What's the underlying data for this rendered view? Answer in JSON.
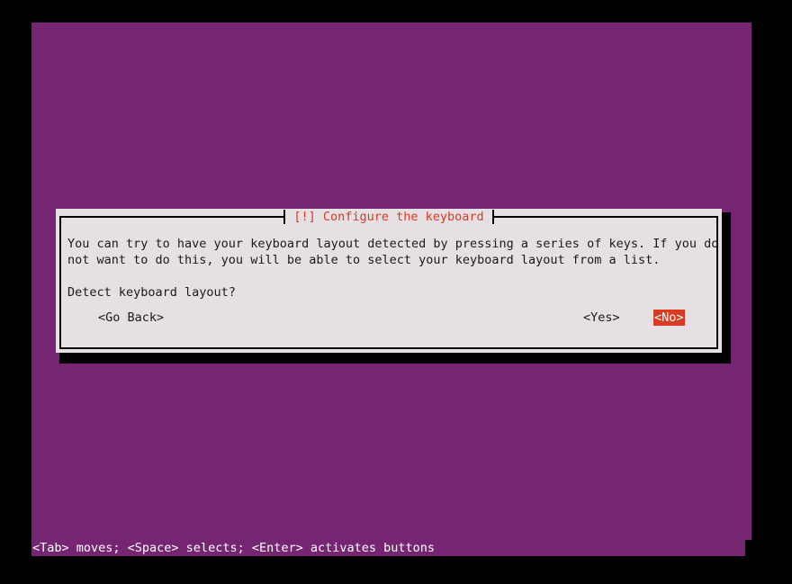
{
  "screen": {
    "background_color": "#000000",
    "terminal_background": "#762572",
    "dialog_background": "#e6e0e4",
    "accent_red": "#d93b22",
    "text_color": "#1a1a1a",
    "highlight_text_color": "#ffffff"
  },
  "dialog": {
    "title": "[!] Configure the keyboard",
    "body_lines": [
      "You can try to have your keyboard layout detected by pressing a series of keys. If you do",
      "not want to do this, you will be able to select your keyboard layout from a list."
    ],
    "question": "Detect keyboard layout?",
    "buttons": [
      {
        "label": "<Go Back>",
        "selected": false
      },
      {
        "label": "<Yes>",
        "selected": false
      },
      {
        "label": "<No>",
        "selected": true
      }
    ]
  },
  "status_bar": {
    "hint": "<Tab> moves; <Space> selects; <Enter> activates buttons"
  }
}
